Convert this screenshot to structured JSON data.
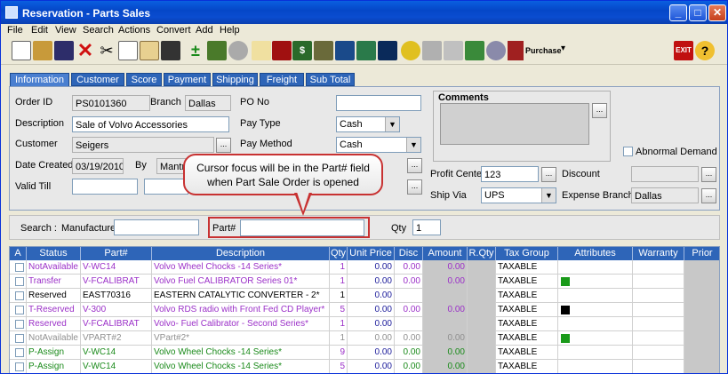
{
  "window": {
    "title": "Reservation - Parts Sales"
  },
  "menu": [
    "File",
    "Edit",
    "View",
    "Search",
    "Actions",
    "Convert",
    "Add",
    "Help"
  ],
  "toolbar": {
    "purchase_label": "Purchase"
  },
  "tabs": [
    "Information",
    "Customer",
    "Score",
    "Payment",
    "Shipping",
    "Freight",
    "Sub Total"
  ],
  "info": {
    "order_id_label": "Order ID",
    "order_id": "PS0101360",
    "branch_label": "Branch",
    "branch": "Dallas",
    "po_label": "PO No",
    "po": "",
    "desc_label": "Description",
    "desc": "Sale of Volvo Accessories",
    "paytype_label": "Pay Type",
    "paytype": "Cash",
    "customer_label": "Customer",
    "customer": "Seigers",
    "paymethod_label": "Pay Method",
    "paymethod": "Cash",
    "date_label": "Date Created",
    "date": "03/19/2010",
    "by_label": "By",
    "by": "Mantra",
    "valid_label": "Valid Till",
    "comments_label": "Comments",
    "abnormal_label": "Abnormal Demand",
    "profit_label": "Profit Center",
    "profit": "123",
    "discount_label": "Discount",
    "shipvia_label": "Ship Via",
    "shipvia": "UPS",
    "expense_label": "Expense Branch",
    "expense": "Dallas"
  },
  "search": {
    "label": "Search :",
    "manufacturer_label": "Manufacturer",
    "part_label": "Part#",
    "qty_label": "Qty",
    "qty": "1"
  },
  "callout": {
    "line1": "Cursor focus will be in the Part# field",
    "line2": "when Part Sale Order is opened"
  },
  "grid": {
    "headers": [
      "A",
      "Status",
      "Part#",
      "Description",
      "Qty",
      "Unit Price",
      "Disc",
      "Amount",
      "R.Qty",
      "Tax Group",
      "Attributes",
      "Warranty",
      "Prior"
    ],
    "rows": [
      {
        "status": "NotAvailable",
        "part": "V-WC14",
        "desc": "Volvo Wheel Chocks -14 Series*",
        "qty": "1",
        "price": "0.00",
        "disc": "0.00",
        "amount": "0.00",
        "tax": "TAXABLE",
        "color": "#9b30c8",
        "attr": ""
      },
      {
        "status": "Transfer",
        "part": "V-FCALIBRAT",
        "desc": "Volvo Fuel CALIBRATOR Series 01*",
        "qty": "1",
        "price": "0.00",
        "disc": "0.00",
        "amount": "0.00",
        "tax": "TAXABLE",
        "color": "#9b30c8",
        "attr": "#1a9a1a"
      },
      {
        "status": "Reserved",
        "part": "EAST70316",
        "desc": "EASTERN CATALYTIC CONVERTER - 2*",
        "qty": "1",
        "price": "0.00",
        "disc": "",
        "amount": "",
        "tax": "TAXABLE",
        "color": "#000000",
        "attr": ""
      },
      {
        "status": "T-Reserved",
        "part": "V-300",
        "desc": "Volvo RDS radio with Front Fed CD Player*",
        "qty": "5",
        "price": "0.00",
        "disc": "0.00",
        "amount": "0.00",
        "tax": "TAXABLE",
        "color": "#9b30c8",
        "attr": "#000000"
      },
      {
        "status": "Reserved",
        "part": "V-FCALIBRAT",
        "desc": "Volvo- Fuel Calibrator - Second Series*",
        "qty": "1",
        "price": "0.00",
        "disc": "",
        "amount": "",
        "tax": "TAXABLE",
        "color": "#9b30c8",
        "attr": ""
      },
      {
        "status": "NotAvailable",
        "part": "VPART#2",
        "desc": "VPart#2*",
        "qty": "1",
        "price": "0.00",
        "disc": "0.00",
        "amount": "0.00",
        "tax": "TAXABLE",
        "color": "#909090",
        "attr": "#1a9a1a"
      },
      {
        "status": "P-Assign",
        "part": "V-WC14",
        "desc": "Volvo Wheel Chocks -14 Series*",
        "qty": "9",
        "price": "0.00",
        "disc": "0.00",
        "amount": "0.00",
        "tax": "TAXABLE",
        "color": "#1a8a1a",
        "attr": ""
      },
      {
        "status": "P-Assign",
        "part": "V-WC14",
        "desc": "Volvo Wheel Chocks -14 Series*",
        "qty": "5",
        "price": "0.00",
        "disc": "0.00",
        "amount": "0.00",
        "tax": "TAXABLE",
        "color": "#1a8a1a",
        "attr": ""
      }
    ]
  }
}
